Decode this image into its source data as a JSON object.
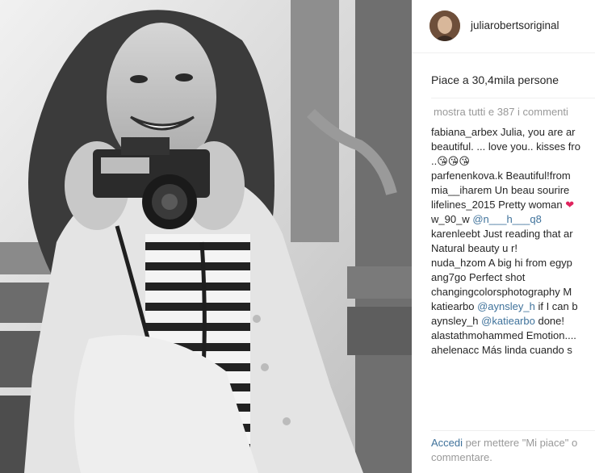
{
  "post": {
    "image_alt": "",
    "author": {
      "username": "juliarobertsoriginal"
    },
    "likes_text": "Piace a 30,4mila persone",
    "show_all_comments": "mostra tutti e 387 i commenti",
    "comments": [
      {
        "user": "fabiana_arbex",
        "segments": [
          {
            "text": " Julia, you are ar"
          }
        ],
        "continuation": [
          "beautiful. ... love you.. kisses fro",
          "..😘😘😘"
        ]
      },
      {
        "user": "parfenenkova.k",
        "segments": [
          {
            "text": " Beautiful!from"
          }
        ]
      },
      {
        "user": "mia__iharem",
        "segments": [
          {
            "text": " Un beau sourire"
          }
        ]
      },
      {
        "user": "lifelines_2015",
        "segments": [
          {
            "text": " Pretty woman "
          },
          {
            "text": "❤",
            "heart": true
          }
        ]
      },
      {
        "user": "w_90_w",
        "segments": [
          {
            "text": " "
          },
          {
            "text": "@n___h___q8",
            "mention": true
          }
        ]
      },
      {
        "user": "karenleebt",
        "segments": [
          {
            "text": " Just reading that ar"
          }
        ],
        "continuation": [
          "Natural beauty u r!"
        ]
      },
      {
        "user": "nuda_hzom",
        "segments": [
          {
            "text": " A big hi from egyp"
          }
        ]
      },
      {
        "user": "ang7go",
        "segments": [
          {
            "text": " Perfect shot"
          }
        ]
      },
      {
        "user": "changingcolorsphotography",
        "segments": [
          {
            "text": " M"
          }
        ]
      },
      {
        "user": "katiearbo",
        "segments": [
          {
            "text": " "
          },
          {
            "text": "@aynsley_h",
            "mention": true
          },
          {
            "text": " if I can b"
          }
        ]
      },
      {
        "user": "aynsley_h",
        "segments": [
          {
            "text": " "
          },
          {
            "text": "@katiearbo",
            "mention": true
          },
          {
            "text": " done!"
          }
        ]
      },
      {
        "user": "alastathmohammed",
        "segments": [
          {
            "text": " Emotion...."
          }
        ]
      },
      {
        "user": "ahelenacc",
        "segments": [
          {
            "text": " Más linda cuando s"
          }
        ]
      }
    ],
    "login_link": "Accedi",
    "login_prompt": " per mettere \"Mi piace\" o",
    "login_prompt_line2": "commentare."
  },
  "colors": {
    "link": "#3f729b",
    "muted": "#999999",
    "text": "#262626",
    "heart": "#e0245e"
  }
}
